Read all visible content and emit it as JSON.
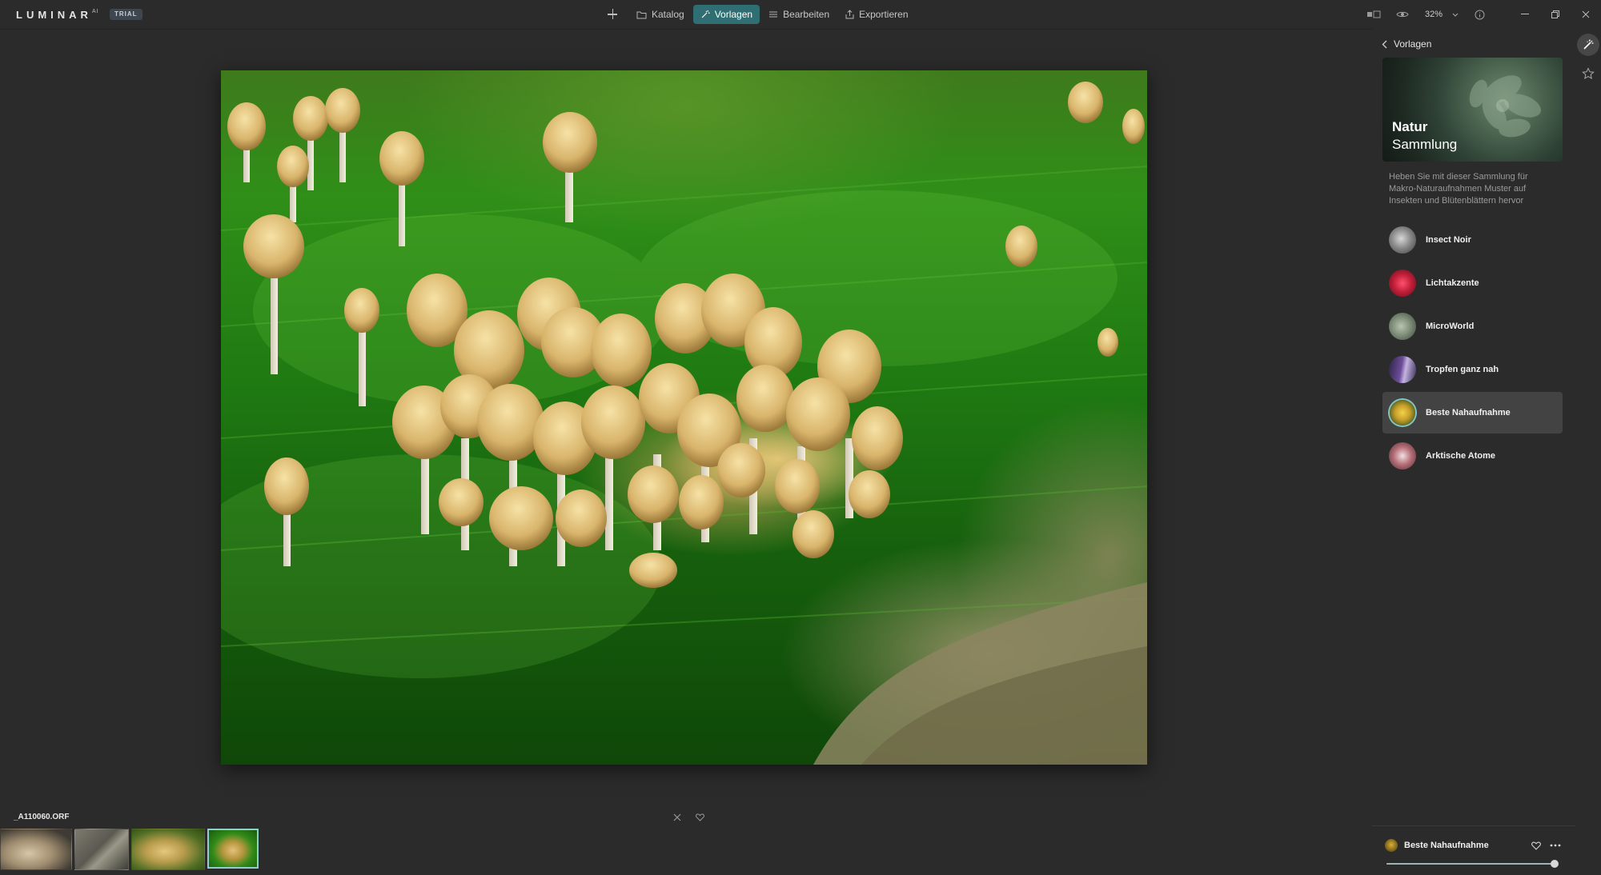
{
  "app": {
    "logo": "LUMINAR",
    "logo_sup": "AI",
    "badge": "TRIAL"
  },
  "nav": {
    "items": [
      {
        "label": "Katalog",
        "icon": "folder-icon"
      },
      {
        "label": "Vorlagen",
        "icon": "templates-icon"
      },
      {
        "label": "Bearbeiten",
        "icon": "sliders-icon"
      },
      {
        "label": "Exportieren",
        "icon": "export-icon"
      }
    ],
    "active": "Vorlagen"
  },
  "view": {
    "zoom": "32%"
  },
  "file": {
    "name": "_A110060.ORF"
  },
  "panel": {
    "back_label": "Vorlagen",
    "collection": {
      "title_line1": "Natur",
      "title_line2": "Sammlung",
      "description": "Heben Sie mit dieser Sammlung für Makro-Naturaufnahmen Muster auf Insekten und Blütenblättern hervor"
    },
    "presets": [
      {
        "label": "Insect Noir",
        "color": "#8a8a8a"
      },
      {
        "label": "Lichtakzente",
        "color": "#c4203a"
      },
      {
        "label": "MicroWorld",
        "color": "#7f8f7a"
      },
      {
        "label": "Tropfen ganz nah",
        "color": "#6d4c9a"
      },
      {
        "label": "Beste Nahaufnahme",
        "color": "#c9a12c",
        "selected": true
      },
      {
        "label": "Arktische Atome",
        "color": "#b8707a"
      }
    ],
    "applied": {
      "label": "Beste Nahaufnahme",
      "amount": 0.99
    }
  },
  "colors": {
    "accent": "#2f6f73",
    "accent_light": "#7ec7c4"
  }
}
